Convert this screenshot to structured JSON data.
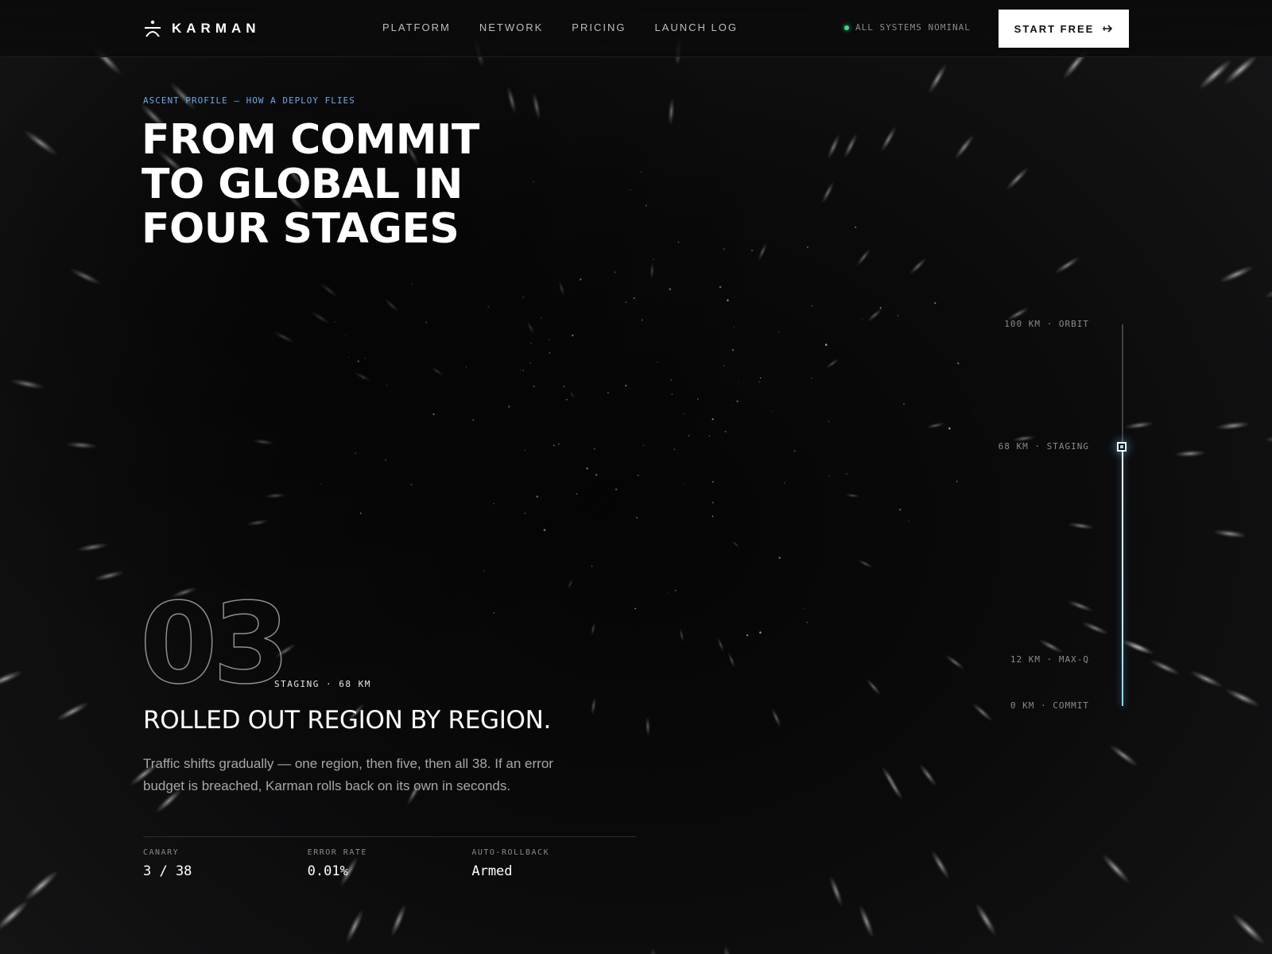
{
  "brand": {
    "name": "KARMAN",
    "logo_icon": "ascent-logo-icon"
  },
  "nav": {
    "links": [
      "PLATFORM",
      "NETWORK",
      "PRICING",
      "LAUNCH LOG"
    ],
    "status": {
      "text": "ALL SYSTEMS NOMINAL",
      "color": "#3ddc84"
    },
    "cta": {
      "label": "START FREE",
      "icon": "arrow-right-icon"
    }
  },
  "hero": {
    "eyebrow": "ASCENT PROFILE — HOW A DEPLOY FLIES",
    "headline_lines": [
      "FROM COMMIT",
      "TO GLOBAL IN",
      "FOUR STAGES"
    ]
  },
  "altitude": {
    "labels": [
      "100 KM · ORBIT",
      "68 KM · STAGING",
      "12 KM · MAX-Q",
      "0 KM · COMMIT"
    ],
    "max_km": 100,
    "current_km": 68
  },
  "stage": {
    "number": "03",
    "tag": "STAGING · 68 KM",
    "title": "ROLLED OUT REGION BY REGION.",
    "body": "Traffic shifts gradually — one region, then five, then all 38. If an error budget is breached, Karman rolls back on its own in seconds.",
    "metrics": [
      {
        "label": "CANARY",
        "value": "3 / 38"
      },
      {
        "label": "ERROR RATE",
        "value": "0.01%"
      },
      {
        "label": "AUTO-ROLLBACK",
        "value": "Armed"
      }
    ]
  },
  "colors": {
    "accent": "#6aa9e6",
    "status": "#3ddc84",
    "background": "#070707"
  }
}
